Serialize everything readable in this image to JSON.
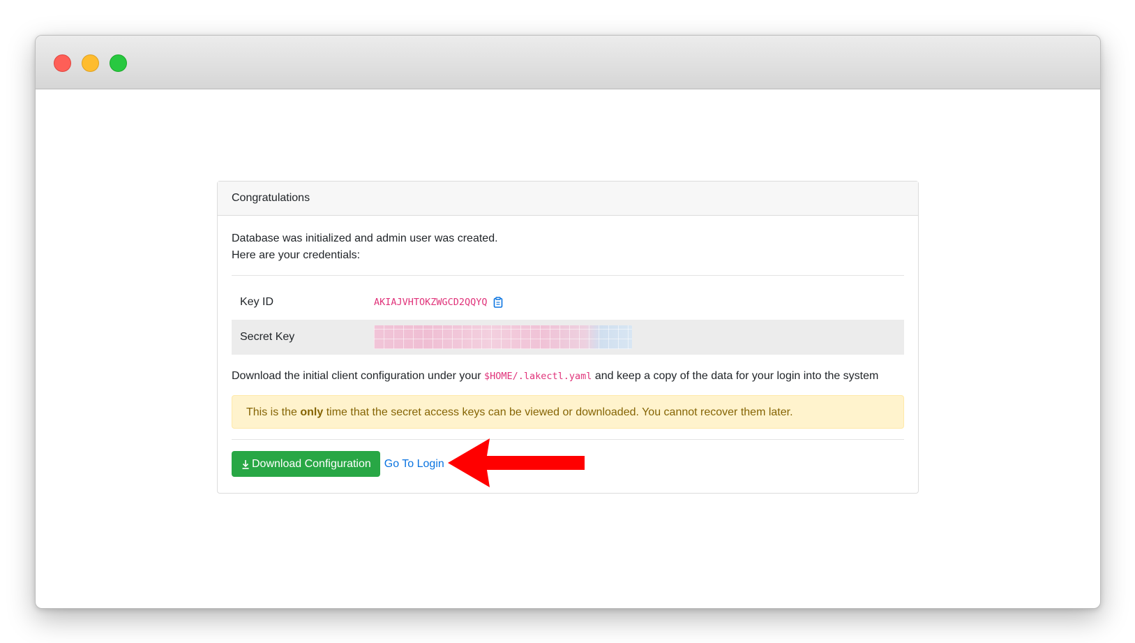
{
  "card": {
    "header": "Congratulations",
    "intro_line1": "Database was initialized and admin user was created.",
    "intro_line2": "Here are your credentials:"
  },
  "credentials": {
    "key_id_label": "Key ID",
    "key_id_value": "AKIAJVHTOKZWGCD2QQYQ",
    "secret_key_label": "Secret Key"
  },
  "download_text": {
    "before": "Download the initial client configuration under your ",
    "path": "$HOME/.lakectl.yaml",
    "after": " and keep a copy of the data for your login into the system"
  },
  "alert": {
    "before": "This is the ",
    "bold": "only",
    "after": " time that the secret access keys can be viewed or downloaded. You cannot recover them later."
  },
  "actions": {
    "download_label": "Download Configuration",
    "login_label": "Go To Login"
  },
  "icons": {
    "copy": "clipboard-icon",
    "download": "download-icon",
    "annotation": "red-arrow"
  },
  "colors": {
    "code": "#e0337a",
    "success": "#28a745",
    "link": "#0a74e0",
    "alert_bg": "#fff3cd",
    "alert_text": "#856404",
    "arrow": "#ff0000"
  }
}
